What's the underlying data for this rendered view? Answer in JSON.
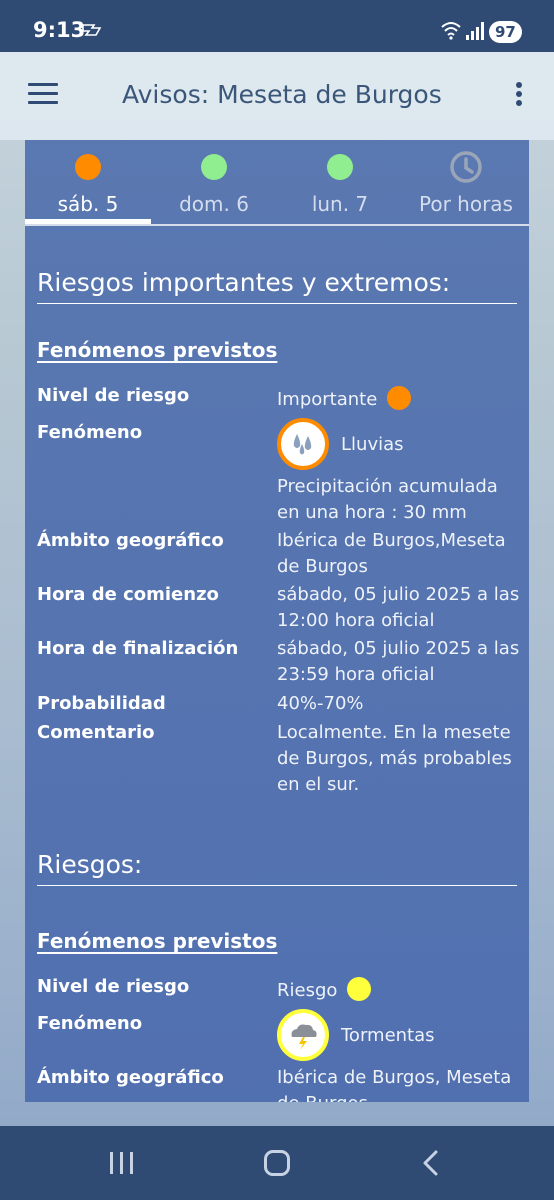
{
  "status": {
    "time": "9:13",
    "battery": "97",
    "notification_icon": "notification-app-icon",
    "wifi_icon": "wifi-icon",
    "signal_icon": "signal-icon"
  },
  "app_bar": {
    "title": "Avisos: Meseta de Burgos",
    "menu_icon": "hamburger-menu-icon",
    "more_icon": "more-vert-icon"
  },
  "tabs": [
    {
      "label": "sáb. 5",
      "status_color": "#ff8c00",
      "active": true
    },
    {
      "label": "dom. 6",
      "status_color": "#90ee90",
      "active": false
    },
    {
      "label": "lun. 7",
      "status_color": "#90ee90",
      "active": false
    },
    {
      "label": "Por horas",
      "icon": "clock-icon",
      "active": false
    }
  ],
  "section_important": {
    "title": "Riesgos importantes y extremos:",
    "subtitle": "Fenómenos previstos",
    "rows": {
      "nivel_label": "Nivel de riesgo",
      "nivel_value": "Importante",
      "nivel_color": "#ff8c00",
      "fenomeno_label": "Fenómeno",
      "fenomeno_value": "Lluvias",
      "fenomeno_icon": "rain-drops-icon",
      "fenomeno_detail": "Precipitación acumulada en una hora : 30 mm",
      "ambito_label": "Ámbito geográfico",
      "ambito_value": "Ibérica de Burgos,Meseta de Burgos",
      "comienzo_label": "Hora de comienzo",
      "comienzo_value": "sábado, 05 julio 2025 a las 12:00 hora oficial",
      "fin_label": "Hora de finalización",
      "fin_value": "sábado, 05 julio 2025 a las 23:59 hora oficial",
      "prob_label": "Probabilidad",
      "prob_value": "40%-70%",
      "coment_label": "Comentario",
      "coment_value": "Localmente. En la mesete de Burgos, más probables en el sur."
    }
  },
  "section_risks": {
    "title": "Riesgos:",
    "subtitle": "Fenómenos previstos",
    "rows": {
      "nivel_label": "Nivel de riesgo",
      "nivel_value": "Riesgo",
      "nivel_color": "#ffff3c",
      "fenomeno_label": "Fenómeno",
      "fenomeno_value": "Tormentas",
      "fenomeno_icon": "storm-cloud-icon",
      "ambito_label": "Ámbito geográfico",
      "ambito_value": "Ibérica de Burgos, Meseta de Burgos"
    }
  },
  "nav": {
    "recents_icon": "recents-icon",
    "home_icon": "home-icon",
    "back_icon": "back-icon"
  }
}
